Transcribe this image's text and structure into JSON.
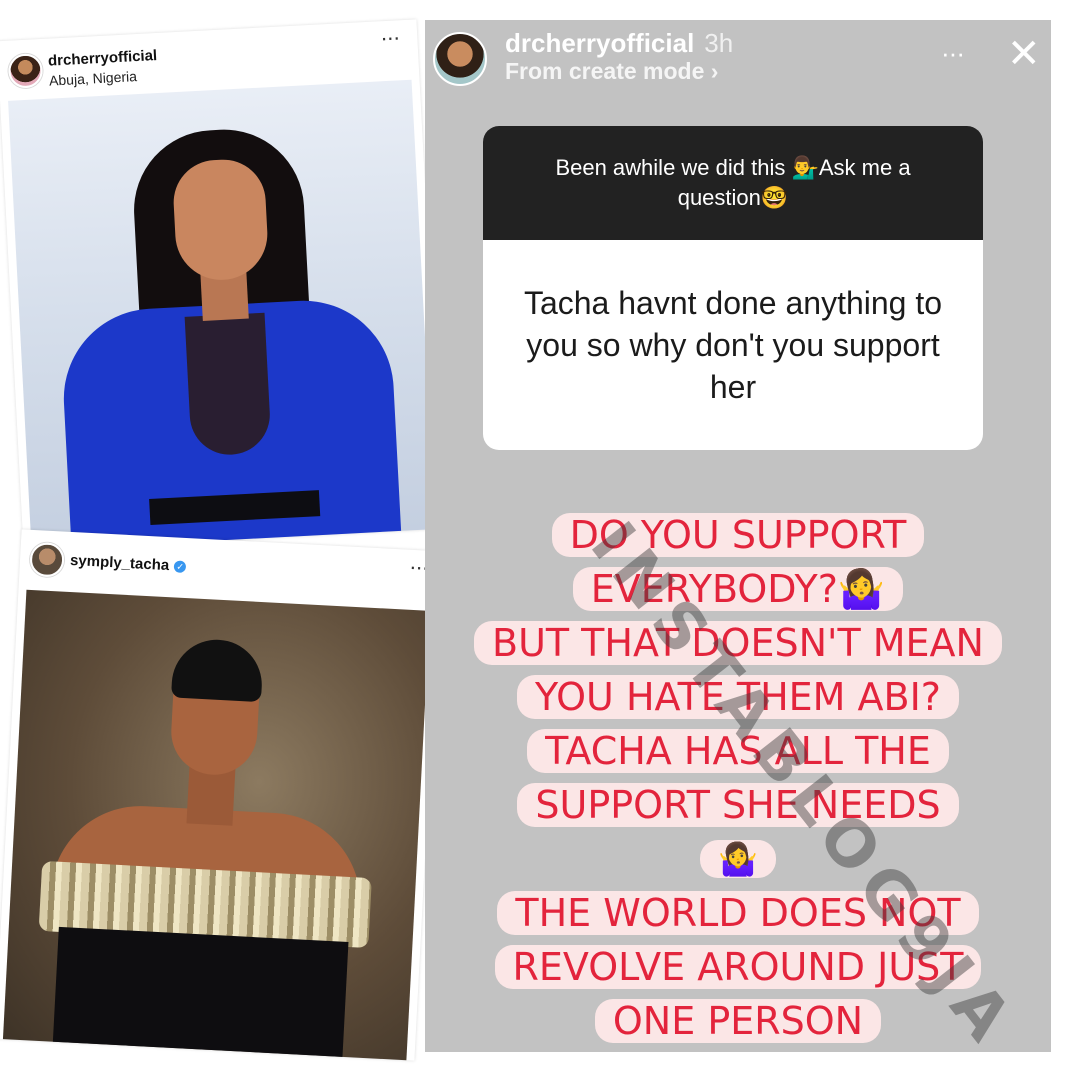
{
  "post1": {
    "username": "drcherryofficial",
    "location": "Abuja, Nigeria",
    "more_icon": "···"
  },
  "post2": {
    "username": "symply_tacha",
    "verified_icon": "✓",
    "more_icon": "···"
  },
  "story": {
    "username": "drcherryofficial",
    "time": "3h",
    "subtitle": "From create mode ›",
    "more_icon": "···",
    "close_icon": "✕",
    "question_prompt": "Been awhile we did this 💁‍♂️Ask me a question🤓",
    "question_text": "Tacha havnt done anything to you so why don't you support her",
    "answer_lines": [
      "DO YOU SUPPORT",
      "EVERYBODY?🤷‍♀️",
      "BUT THAT DOESN'T MEAN",
      "YOU HATE THEM ABI?",
      "TACHA HAS ALL THE",
      "SUPPORT SHE NEEDS",
      "🤷‍♀️",
      "THE WORLD DOES NOT",
      "REVOLVE AROUND JUST",
      "ONE PERSON"
    ],
    "watermark": "INSTABLOG9JA"
  },
  "colors": {
    "story_bg": "#c2c2c2",
    "answer_text": "#e3243c",
    "answer_bg": "#fbe6e6",
    "question_header": "#222222",
    "verified": "#3897f0",
    "dress_blue": "#1c38c9"
  }
}
